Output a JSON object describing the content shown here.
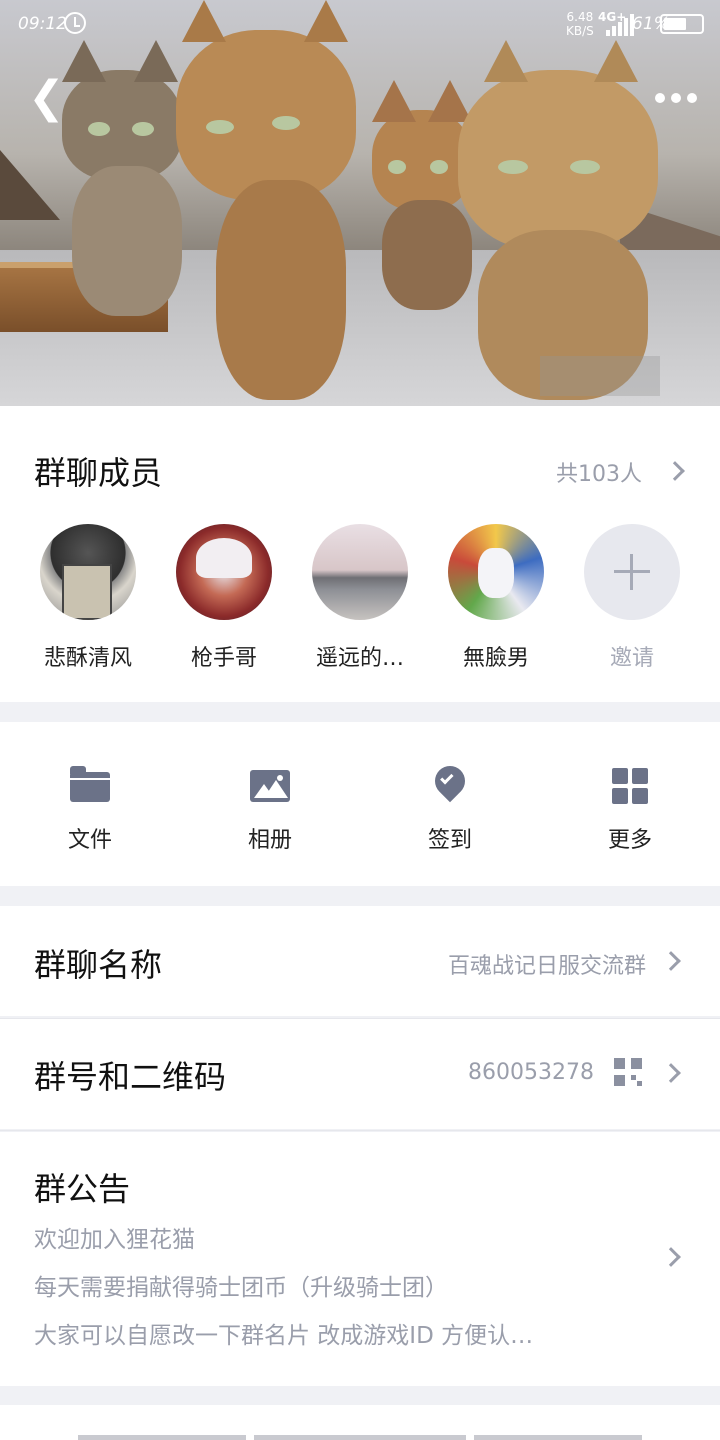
{
  "status_bar": {
    "time": "09:12",
    "speed_value": "6.48",
    "speed_unit": "KB/S",
    "network": "4G+",
    "battery": "61%",
    "battery_level": 0.61
  },
  "hero": {
    "back_icon": "back-arrow-icon",
    "more_icon": "more-dots-icon"
  },
  "members": {
    "title": "群聊成员",
    "count": "共103人",
    "list": [
      {
        "name": "悲酥清风"
      },
      {
        "name": "枪手哥"
      },
      {
        "name": "遥远的…"
      },
      {
        "name": "無臉男"
      }
    ],
    "invite_label": "邀请"
  },
  "actions": [
    {
      "label": "文件",
      "icon": "folder-icon"
    },
    {
      "label": "相册",
      "icon": "photo-album-icon"
    },
    {
      "label": "签到",
      "icon": "check-in-icon"
    },
    {
      "label": "更多",
      "icon": "more-grid-icon"
    }
  ],
  "group_name": {
    "label": "群聊名称",
    "value": "百魂战记日服交流群"
  },
  "group_id": {
    "label": "群号和二维码",
    "value": "860053278"
  },
  "notice": {
    "label": "群公告",
    "lines": [
      "欢迎加入狸花猫",
      "每天需要捐献得骑士团币（升级骑士团）",
      "大家可以自愿改一下群名片 改成游戏ID 方便认…"
    ]
  }
}
